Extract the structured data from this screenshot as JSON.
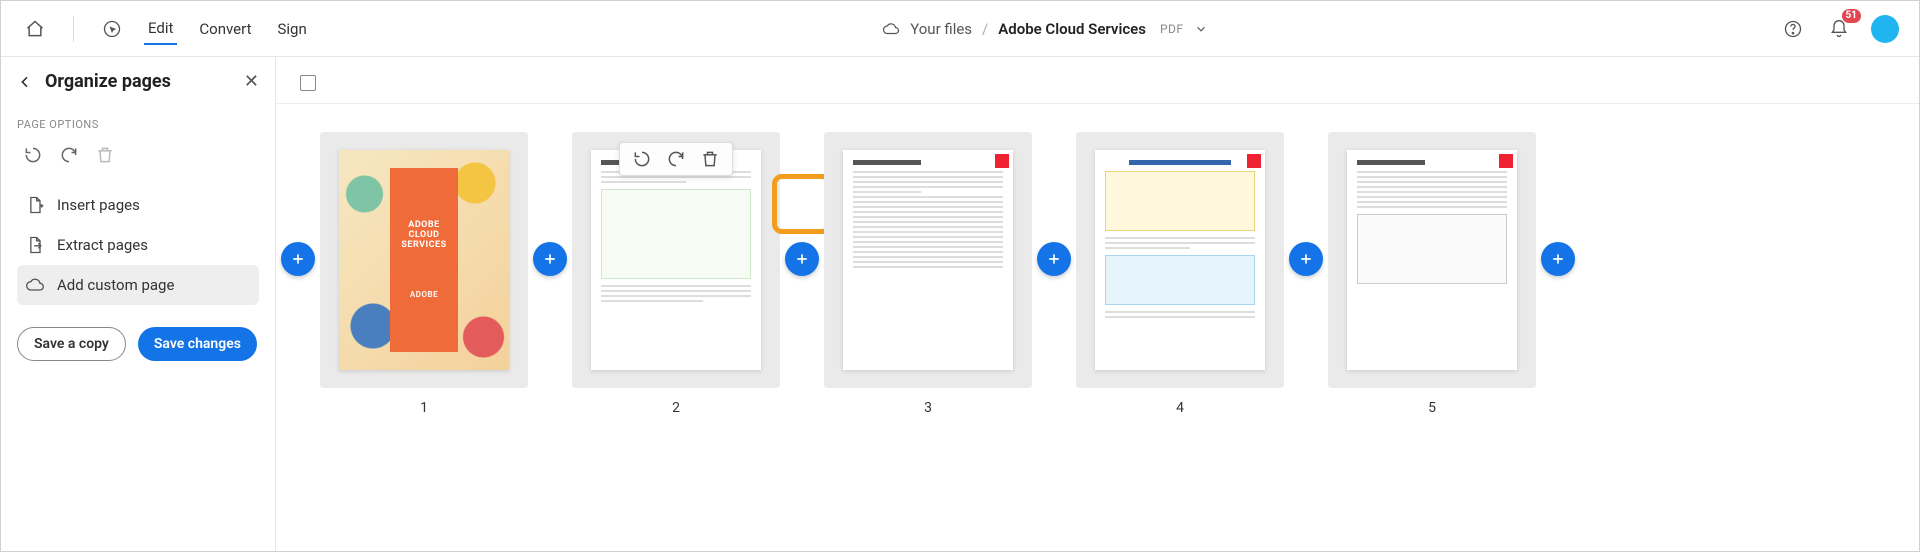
{
  "topbar": {
    "menu": {
      "edit": "Edit",
      "convert": "Convert",
      "sign": "Sign"
    },
    "crumb_root": "Your files",
    "doc_title": "Adobe Cloud Services",
    "doc_ext": "PDF",
    "badge": "51"
  },
  "sidebar": {
    "title": "Organize pages",
    "section": "PAGE OPTIONS",
    "insert": "Insert pages",
    "extract": "Extract pages",
    "addcustom": "Add custom page",
    "save_copy": "Save a copy",
    "save_changes": "Save changes"
  },
  "pages": {
    "p1": "1",
    "p2": "2",
    "p3": "3",
    "p4": "4",
    "p5": "5",
    "cover_title_l1": "ADOBE CLOUD",
    "cover_title_l2": "SERVICES",
    "cover_brand": "ADOBE"
  }
}
